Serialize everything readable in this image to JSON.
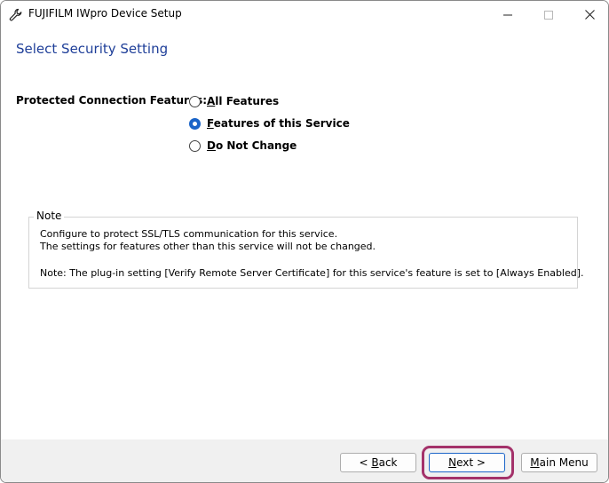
{
  "window": {
    "title": "FUJIFILM IWpro Device Setup",
    "icon": "wrench-icon"
  },
  "page": {
    "title": "Select Security Setting"
  },
  "form": {
    "label": "Protected Connection Features:",
    "options": [
      {
        "accel": "A",
        "rest": "ll Features",
        "checked": false
      },
      {
        "accel": "F",
        "rest": "eatures of this Service",
        "checked": true
      },
      {
        "accel": "D",
        "rest": "o Not Change",
        "checked": false
      }
    ]
  },
  "note": {
    "legend": "Note",
    "line1": "Configure to protect SSL/TLS communication for this service.",
    "line2": "The settings for features other than this service will not be changed.",
    "line3": "Note: The plug-in setting [Verify Remote Server Certificate] for this service's feature is set to [Always Enabled]."
  },
  "buttons": {
    "back_prefix": "< ",
    "back_accel": "B",
    "back_rest": "ack",
    "next_accel": "N",
    "next_rest": "ext >",
    "main_accel": "M",
    "main_rest": "ain Menu"
  },
  "colors": {
    "title_blue": "#1f3f99",
    "accent": "#1a64c8",
    "highlight": "#a4326a"
  }
}
